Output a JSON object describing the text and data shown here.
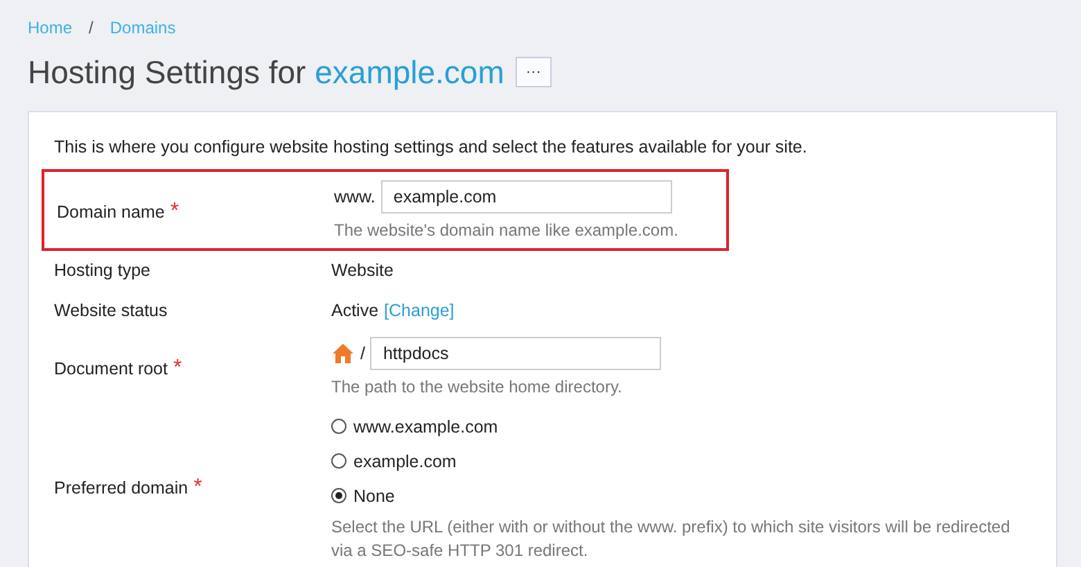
{
  "breadcrumbs": [
    {
      "label": "Home"
    },
    {
      "label": "Domains"
    }
  ],
  "breadcrumb_separator": "/",
  "required_mark": "*",
  "title": {
    "prefix": "Hosting Settings for",
    "domain": "example.com",
    "more_button": "···"
  },
  "intro": "This is where you configure website hosting settings and select the features available for your site.",
  "fields": [
    {
      "kind": "input",
      "label": "Domain name",
      "required": true,
      "highlighted": true,
      "prefix": "www.",
      "value": "example.com",
      "hint": "The website's domain name like example.com."
    },
    {
      "kind": "text",
      "label": "Hosting type",
      "required": false,
      "highlighted": false,
      "value": "Website"
    },
    {
      "kind": "status",
      "label": "Website status",
      "required": false,
      "highlighted": false,
      "value": "Active",
      "link": "[Change]"
    },
    {
      "kind": "path",
      "label": "Document root",
      "required": true,
      "highlighted": false,
      "prefix": "/",
      "value": "httpdocs",
      "hint": "The path to the website home directory."
    },
    {
      "kind": "radio",
      "label": "Preferred domain",
      "required": true,
      "highlighted": false,
      "options": [
        {
          "label": "www.example.com",
          "selected": false
        },
        {
          "label": "example.com",
          "selected": false
        },
        {
          "label": "None",
          "selected": true
        }
      ],
      "hint": "Select the URL (either with or without the www. prefix) to which site visitors will be redirected via a SEO-safe HTTP 301 redirect."
    }
  ]
}
